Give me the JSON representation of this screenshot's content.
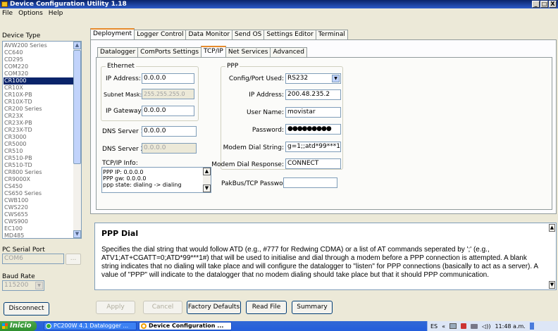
{
  "window": {
    "title": "Device Configuration Utility 1.18",
    "minimize": "_",
    "restore": "□",
    "close": "X"
  },
  "menu": [
    "File",
    "Options",
    "Help"
  ],
  "sidebar": {
    "device_type_label": "Device Type",
    "devices": [
      "AVW200 Series",
      "CC640",
      "CD295",
      "COM220",
      "COM320",
      "CR1000",
      "CR10X",
      "CR10X-PB",
      "CR10X-TD",
      "CR200 Series",
      "CR23X",
      "CR23X-PB",
      "CR23X-TD",
      "CR3000",
      "CR5000",
      "CR510",
      "CR510-PB",
      "CR510-TD",
      "CR800 Series",
      "CR9000X",
      "CS450",
      "CS650 Series",
      "CWB100",
      "CWS220",
      "CWS655",
      "CWS900",
      "EC100",
      "MD485"
    ],
    "selected_device": "CR1000",
    "serial_port_label": "PC Serial Port",
    "serial_port_value": "COM6",
    "browse_label": "...",
    "baud_rate_label": "Baud Rate",
    "baud_rate_value": "115200",
    "disconnect_label": "Disconnect"
  },
  "main_tabs": [
    "Deployment",
    "Logger Control",
    "Data Monitor",
    "Send OS",
    "Settings Editor",
    "Terminal"
  ],
  "sub_tabs": [
    "Datalogger",
    "ComPorts Settings",
    "TCP/IP",
    "Net Services",
    "Advanced"
  ],
  "ethernet": {
    "title": "Ethernet",
    "ip_label": "IP Address:",
    "ip_value": "0.0.0.0",
    "mask_label": "Subnet Mask:",
    "mask_value": "255.255.255.0",
    "gateway_label": "IP Gateway:",
    "gateway_value": "0.0.0.0"
  },
  "dns": {
    "dns1_label": "DNS Server 1:",
    "dns1_value": "0.0.0.0",
    "dns2_label": "DNS Server 2:",
    "dns2_value": "0.0.0.0"
  },
  "tcpip_info": {
    "label": "TCP/IP Info:",
    "lines": [
      "PPP IP: 0.0.0.0",
      "PPP gw: 0.0.0.0",
      "ppp state: dialing -> dialing"
    ]
  },
  "ppp": {
    "title": "PPP",
    "config_port_label": "Config/Port Used:",
    "config_port_value": "RS232",
    "ip_label": "IP Address:",
    "ip_value": "200.48.235.2",
    "user_label": "User Name:",
    "user_value": "movistar",
    "password_label": "Password:",
    "password_value": "●●●●●●●●●",
    "dial_label": "Modem Dial String:",
    "dial_value": "g=1;;atd*99***1#",
    "response_label": "Modem Dial Response:",
    "response_value": "CONNECT"
  },
  "pakbus": {
    "label": "PakBus/TCP Password:",
    "value": ""
  },
  "help": {
    "title": "PPP Dial",
    "text": "Specifies the dial string that would follow ATD (e.g., #777 for Redwing CDMA) or a list of AT commands seperated by ';' (e.g., ATV1;AT+CGATT=0;ATD*99***1#) that will be used to initialise and dial through a modem before a PPP connection is attempted. A blank string indicates that no dialing will take place and will configure the datalogger to \"listen\" for PPP connections (basically to act as a server). A value of \"PPP\" will indicate to the datalogger that no modem dialing should take place but that it should PPP communication."
  },
  "buttons": {
    "apply": "Apply",
    "cancel": "Cancel",
    "factory": "Factory Defaults",
    "read_file": "Read File",
    "summary": "Summary"
  },
  "taskbar": {
    "start": "Inicio",
    "items": [
      "PC200W 4.1 Datalogger ...",
      "Device Configuration ..."
    ],
    "lang": "ES",
    "time": "11:48 a.m."
  }
}
